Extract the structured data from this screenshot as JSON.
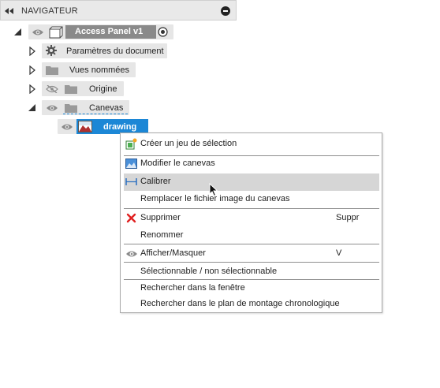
{
  "navigator": {
    "title": "NAVIGATEUR"
  },
  "tree": {
    "root": {
      "label": "Access Panel v1"
    },
    "items": [
      {
        "label": "Paramètres du document"
      },
      {
        "label": "Vues nommées"
      },
      {
        "label": "Origine"
      },
      {
        "label": "Canevas"
      }
    ],
    "canvas_child": {
      "label": "drawing"
    }
  },
  "context_menu": {
    "items": [
      {
        "label": "Créer un jeu de sélection",
        "icon": "selection-set-icon"
      },
      {
        "label": "Modifier le canevas",
        "icon": "edit-canvas-icon"
      },
      {
        "label": "Calibrer",
        "icon": "calibrate-icon",
        "highlighted": true
      },
      {
        "label": "Remplacer le fichier image du canevas"
      },
      {
        "label": "Supprimer",
        "icon": "delete-x-icon",
        "shortcut": "Suppr"
      },
      {
        "label": "Renommer"
      },
      {
        "label": "Afficher/Masquer",
        "icon": "eye-icon",
        "shortcut": "V"
      },
      {
        "label": "Sélectionnable / non sélectionnable"
      },
      {
        "label": "Rechercher dans la fenêtre"
      },
      {
        "label": "Rechercher dans le plan de montage chronologique"
      }
    ]
  },
  "colors": {
    "selection": "#1c87d6",
    "header_bg": "#e9e9e9",
    "highlight_bg": "#d6d6d6",
    "delete_red": "#e02020"
  }
}
